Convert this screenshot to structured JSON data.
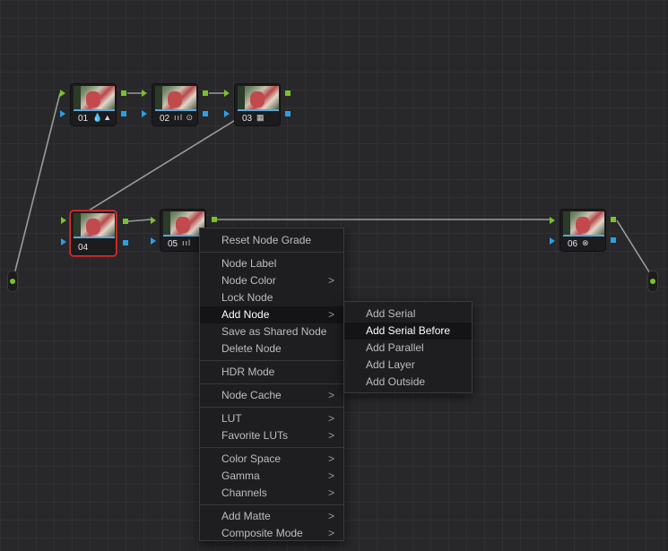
{
  "nodes": [
    {
      "label": "01",
      "icons": "💧▲"
    },
    {
      "label": "02",
      "icons": "ııl ⊙"
    },
    {
      "label": "03",
      "icons": "▦"
    },
    {
      "label": "04",
      "icons": ""
    },
    {
      "label": "05",
      "icons": "ııl"
    },
    {
      "label": "06",
      "icons": "⊗"
    }
  ],
  "context_menu": {
    "reset_node_grade": "Reset Node Grade",
    "node_label": "Node Label",
    "node_color": "Node Color",
    "lock_node": "Lock Node",
    "add_node": "Add Node",
    "save_as_shared_node": "Save as Shared Node",
    "delete_node": "Delete Node",
    "hdr_mode": "HDR Mode",
    "node_cache": "Node Cache",
    "lut": "LUT",
    "favorite_luts": "Favorite LUTs",
    "color_space": "Color Space",
    "gamma": "Gamma",
    "channels": "Channels",
    "add_matte": "Add Matte",
    "composite_mode": "Composite Mode",
    "submenu_arrow": ">"
  },
  "add_node_submenu": {
    "add_serial": "Add Serial",
    "add_serial_before": "Add Serial Before",
    "add_parallel": "Add Parallel",
    "add_layer": "Add Layer",
    "add_outside": "Add Outside"
  },
  "colors": {
    "rgb_link": "#7ac22b",
    "key_link": "#2a9fe8",
    "selected_border": "#dd3333",
    "canvas": "#28282b"
  }
}
